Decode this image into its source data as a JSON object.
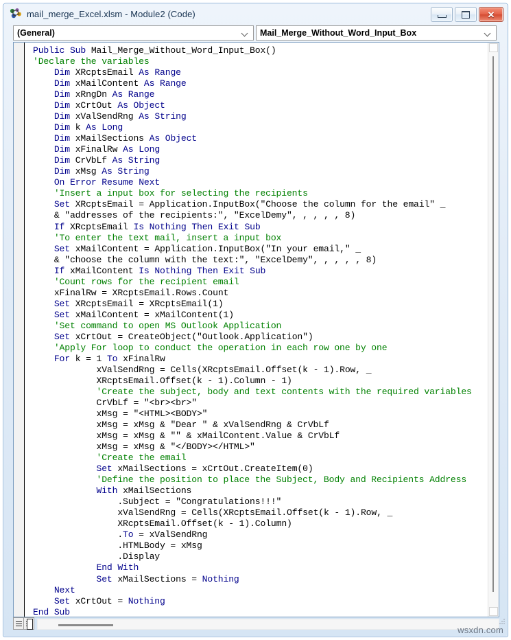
{
  "window": {
    "title": "mail_merge_Excel.xlsm - Module2 (Code)",
    "icon": "vba-module-icon",
    "buttons": {
      "minimize": "Minimize",
      "maximize": "Maximize",
      "close": "Close"
    }
  },
  "toolbar": {
    "object_combo": {
      "value": "(General)",
      "icon": "chevron-down-icon"
    },
    "procedure_combo": {
      "value": "Mail_Merge_Without_Word_Input_Box",
      "icon": "chevron-down-icon"
    }
  },
  "editor": {
    "code": "Public Sub Mail_Merge_Without_Word_Input_Box()\n'Declare the variables\n    Dim XRcptsEmail As Range\n    Dim xMailContent As Range\n    Dim xRngDn As Range\n    Dim xCrtOut As Object\n    Dim xValSendRng As String\n    Dim k As Long\n    Dim xMailSections As Object\n    Dim xFinalRw As Long\n    Dim CrVbLf As String\n    Dim xMsg As String\n    On Error Resume Next\n    'Insert a input box for selecting the recipients\n    Set XRcptsEmail = Application.InputBox(\"Choose the column for the email\" _\n    & \"addresses of the recipients:\", \"ExcelDemy\", , , , , 8)\n    If XRcptsEmail Is Nothing Then Exit Sub\n    'To enter the text mail, insert a input box\n    Set xMailContent = Application.InputBox(\"In your email,\" _\n    & \"choose the column with the text:\", \"ExcelDemy\", , , , , 8)\n    If xMailContent Is Nothing Then Exit Sub\n    'Count rows for the recipient email\n    xFinalRw = XRcptsEmail.Rows.Count\n    Set XRcptsEmail = XRcptsEmail(1)\n    Set xMailContent = xMailContent(1)\n    'Set command to open MS Outlook Application\n    Set xCrtOut = CreateObject(\"Outlook.Application\")\n    'Apply For loop to conduct the operation in each row one by one\n    For k = 1 To xFinalRw\n            xValSendRng = Cells(XRcptsEmail.Offset(k - 1).Row, _\n            XRcptsEmail.Offset(k - 1).Column - 1)\n            'Create the subject, body and text contents with the required variables\n            CrVbLf = \"<br><br>\"\n            xMsg = \"<HTML><BODY>\"\n            xMsg = xMsg & \"Dear \" & xValSendRng & CrVbLf\n            xMsg = xMsg & \"\" & xMailContent.Value & CrVbLf\n            xMsg = xMsg & \"</BODY></HTML>\"\n            'Create the email\n            Set xMailSections = xCrtOut.CreateItem(0)\n            'Define the position to place the Subject, Body and Recipients Address\n            With xMailSections\n                .Subject = \"Congratulations!!!\"\n                xValSendRng = Cells(XRcptsEmail.Offset(k - 1).Row, _\n                XRcptsEmail.Offset(k - 1).Column)\n                .To = xValSendRng\n                .HTMLBody = xMsg\n                .Display\n            End With\n            Set xMailSections = Nothing\n    Next\n    Set xCrtOut = Nothing\nEnd Sub",
    "colors": {
      "keyword": "#00008B",
      "comment": "#008000",
      "identifier": "#000000",
      "background": "#FFFFFF"
    }
  },
  "status": {
    "procedure_view_button": "Procedure View",
    "full_module_view_button": "Full Module View",
    "watermark": "wsxdn.com"
  }
}
